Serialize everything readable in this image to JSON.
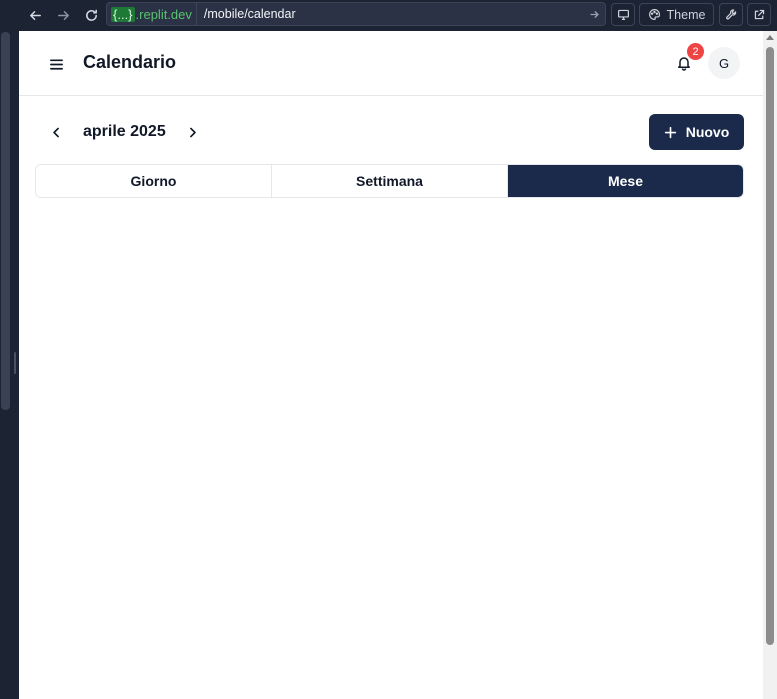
{
  "browser": {
    "domain_brace": "{...}",
    "domain": ".replit.dev",
    "path": "/mobile/calendar",
    "theme_label": "Theme"
  },
  "header": {
    "title": "Calendario",
    "notification_count": "2",
    "avatar_initial": "G"
  },
  "calendar": {
    "month_label": "aprile 2025",
    "new_button_label": "Nuovo",
    "tabs": [
      {
        "label": "Giorno",
        "active": false
      },
      {
        "label": "Settimana",
        "active": false
      },
      {
        "label": "Mese",
        "active": true
      }
    ]
  },
  "colors": {
    "primary": "#1b2a4a",
    "badge": "#ef4444",
    "browser_bg": "#1c2333",
    "domain_green": "#58c270"
  },
  "icons": {
    "back": "arrow-left-icon",
    "forward": "arrow-right-icon",
    "reload": "reload-icon",
    "menu": "hamburger-icon",
    "bell": "bell-icon",
    "prev": "chevron-left-icon",
    "next": "chevron-right-icon",
    "add": "plus-icon"
  }
}
